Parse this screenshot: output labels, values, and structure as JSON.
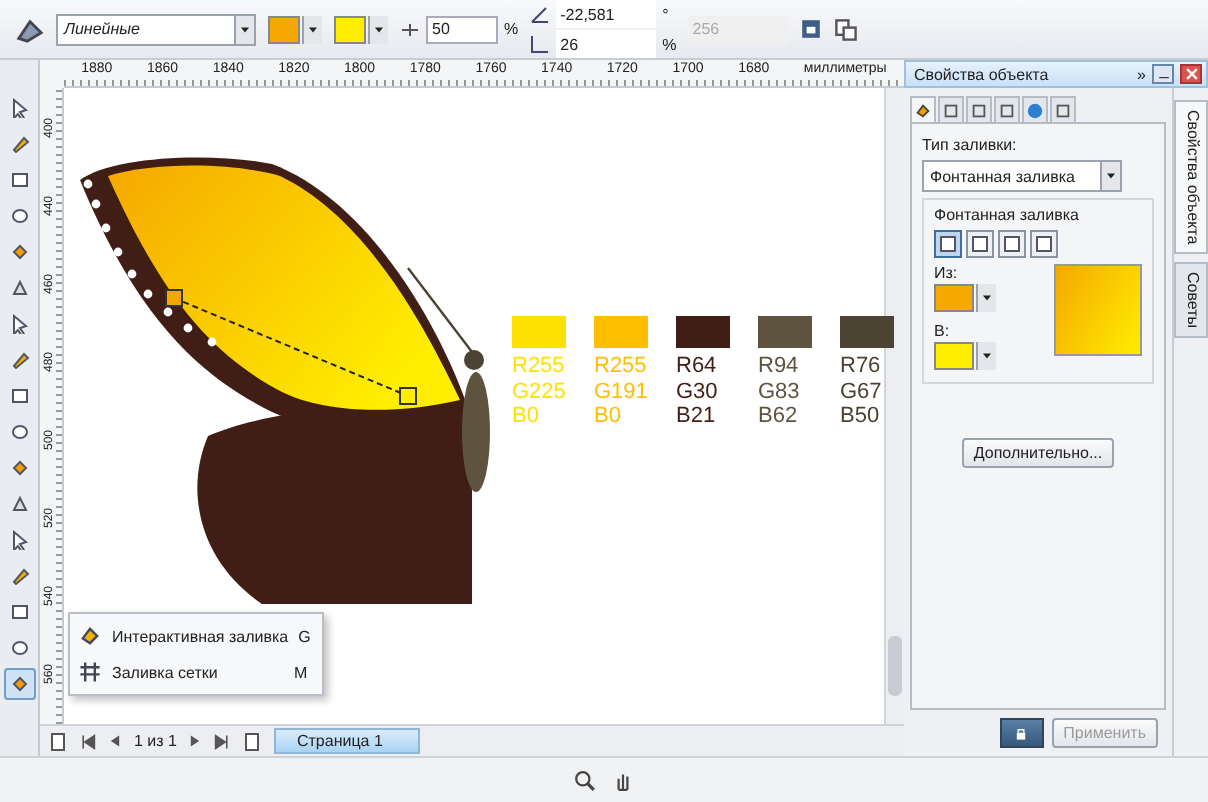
{
  "property_bar": {
    "fill_type": "Линейные",
    "midpoint": "50",
    "midpoint_unit": "%",
    "angle": "-22,581",
    "angle_unit": "°",
    "edge_pad": "26",
    "edge_unit": "%",
    "steps": "256"
  },
  "ruler": {
    "h_labels": [
      "1880",
      "1860",
      "1840",
      "1820",
      "1800",
      "1780",
      "1760",
      "1740",
      "1720",
      "1700",
      "1680"
    ],
    "unit": "миллиметры",
    "v_labels": [
      "400",
      "440",
      "460",
      "480",
      "500",
      "520",
      "540",
      "560"
    ]
  },
  "tools": [
    {
      "selected": false
    },
    {
      "selected": false
    },
    {
      "selected": false
    },
    {
      "selected": false
    },
    {
      "selected": false
    },
    {
      "selected": false
    },
    {
      "selected": false
    },
    {
      "selected": false
    },
    {
      "selected": false
    },
    {
      "selected": false
    },
    {
      "selected": false
    },
    {
      "selected": false
    },
    {
      "selected": false
    },
    {
      "selected": false
    },
    {
      "selected": false
    },
    {
      "selected": false
    },
    {
      "selected": true
    }
  ],
  "swatches": [
    {
      "color": "#ffe100",
      "r": "R255",
      "g": "G225",
      "b": "B0"
    },
    {
      "color": "#ffbf00",
      "r": "R255",
      "g": "G191",
      "b": "B0"
    },
    {
      "color": "#401e15",
      "r": "R64",
      "g": "G30",
      "b": "B21"
    },
    {
      "color": "#5e533e",
      "r": "R94",
      "g": "G83",
      "b": "B62"
    },
    {
      "color": "#4c4332",
      "r": "R76",
      "g": "G67",
      "b": "B50"
    }
  ],
  "flyout": [
    {
      "label": "Интерактивная заливка",
      "shortcut": "G"
    },
    {
      "label": "Заливка сетки",
      "shortcut": "M"
    }
  ],
  "page_nav": {
    "counter": "1 из 1",
    "page_tab": "Страница 1"
  },
  "docker": {
    "title": "Свойства объекта",
    "collapse": "»",
    "tabs": [
      {
        "selected": true
      },
      {
        "selected": false
      },
      {
        "selected": false
      },
      {
        "selected": false
      },
      {
        "selected": false
      },
      {
        "selected": false
      }
    ],
    "fill_type_label": "Тип заливки:",
    "fill_type": "Фонтанная заливка",
    "group_title": "Фонтанная заливка",
    "gradient_types": [
      {
        "selected": true
      },
      {
        "selected": false
      },
      {
        "selected": false
      },
      {
        "selected": false
      }
    ],
    "from_label": "Из:",
    "to_label": "В:",
    "more_button": "Дополнительно...",
    "apply_button": "Применить"
  },
  "side_tabs": [
    {
      "label": "Свойства объекта",
      "selected": true
    },
    {
      "label": "Советы",
      "selected": false
    }
  ]
}
